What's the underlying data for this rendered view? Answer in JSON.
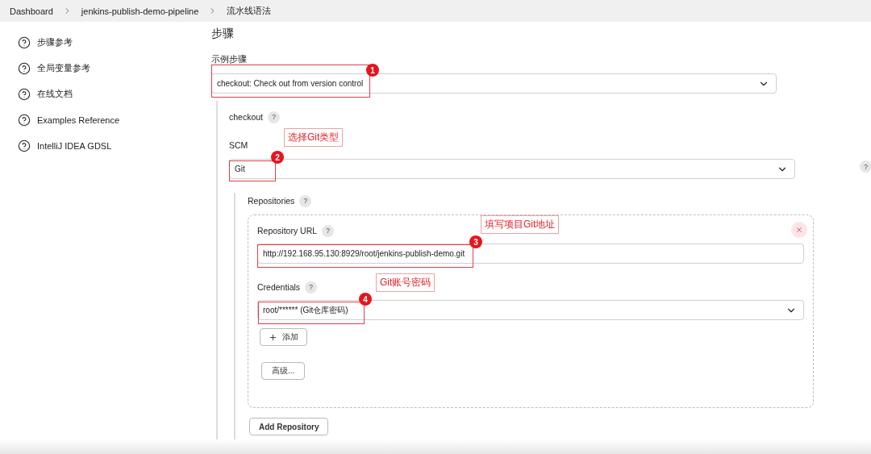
{
  "breadcrumbs": [
    "Dashboard",
    "jenkins-publish-demo-pipeline",
    "流水线语法"
  ],
  "sidebar": {
    "items": [
      {
        "label": "步骤参考"
      },
      {
        "label": "全局变量参考"
      },
      {
        "label": "在线文档"
      },
      {
        "label": "Examples Reference"
      },
      {
        "label": "IntelliJ IDEA GDSL"
      }
    ]
  },
  "section": {
    "title": "步骤",
    "sample_step": {
      "label": "示例步骤",
      "value": "checkout: Check out from version control"
    },
    "checkout": {
      "label": "checkout",
      "help": "?"
    },
    "scm": {
      "label": "SCM",
      "value": "Git",
      "help": "?"
    },
    "repositories": {
      "label": "Repositories",
      "help": "?",
      "items": [
        {
          "url_label": "Repository URL",
          "url_help": "?",
          "url_value": "http://192.168.95.130:8929/root/jenkins-publish-demo.git",
          "credentials_label": "Credentials",
          "credentials_help": "?",
          "credentials_value": "root/****** (Git仓库密码)",
          "add_button": "添加",
          "advanced_button": "高级..."
        }
      ],
      "add_button": "Add Repository"
    }
  },
  "annotations": [
    {
      "number": "1"
    },
    {
      "number": "2",
      "note": "选择Git类型"
    },
    {
      "number": "3",
      "note": "填写项目Git地址"
    },
    {
      "number": "4",
      "note": "Git账号密码"
    }
  ]
}
